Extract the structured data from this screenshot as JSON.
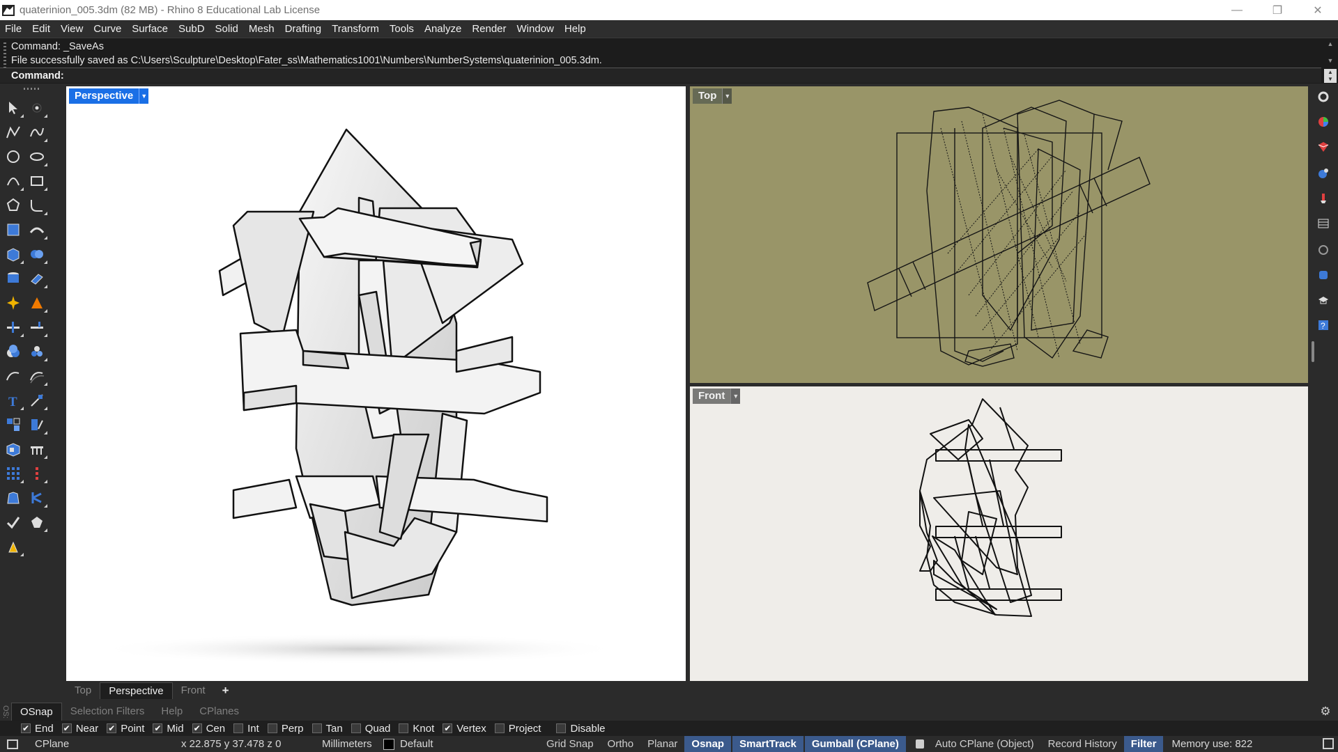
{
  "window": {
    "title": "quaterinion_005.3dm (82 MB) - Rhino 8 Educational Lab License",
    "minimize": "—",
    "restore": "❐",
    "close": "✕"
  },
  "menu": [
    "File",
    "Edit",
    "View",
    "Curve",
    "Surface",
    "SubD",
    "Solid",
    "Mesh",
    "Drafting",
    "Transform",
    "Tools",
    "Analyze",
    "Render",
    "Window",
    "Help"
  ],
  "command": {
    "history": [
      "Command: _SaveAs",
      "File successfully saved as C:\\Users\\Sculpture\\Desktop\\Fater_ss\\Mathematics1001\\Numbers\\NumberSystems\\quaterinion_005.3dm."
    ],
    "prompt": "Command:",
    "input_value": ""
  },
  "toolbar": {
    "tools": [
      "select-arrow-icon",
      "point-icon",
      "polyline-icon",
      "curve-icon",
      "circle-icon",
      "ellipse-icon",
      "arc-icon",
      "rectangle-icon",
      "polygon-icon",
      "fillet-curve-icon",
      "surface-icon",
      "loft-icon",
      "box-icon",
      "sphere-icon",
      "cylinder-icon",
      "extrude-icon",
      "explode-icon",
      "trim-icon",
      "split-icon",
      "join-icon",
      "boolean-union-icon",
      "boolean-split-icon",
      "rebuild-icon",
      "offset-icon",
      "text-icon",
      "dimension-icon",
      "group-icon",
      "move-icon",
      "block-icon",
      "array-icon",
      "grid-array-icon",
      "control-points-icon",
      "properties-icon",
      "analyze-icon",
      "check-icon",
      "render-icon",
      "paint-icon"
    ]
  },
  "viewports": {
    "perspective": {
      "label": "Perspective"
    },
    "top": {
      "label": "Top"
    },
    "front": {
      "label": "Front"
    }
  },
  "viewport_tabs": [
    "Top",
    "Perspective",
    "Front"
  ],
  "viewport_tab_add": "+",
  "right_panel_icons": [
    "settings-gear-icon",
    "color-wheel-icon",
    "material-icon",
    "environment-icon",
    "render-brush-icon",
    "layers-table-icon",
    "display-icon",
    "help-panel-icon",
    "learn-icon",
    "support-icon"
  ],
  "panel_tabs": [
    "OSnap",
    "Selection Filters",
    "Help",
    "CPlanes"
  ],
  "osnap": {
    "items": [
      {
        "label": "End",
        "checked": true
      },
      {
        "label": "Near",
        "checked": true
      },
      {
        "label": "Point",
        "checked": true
      },
      {
        "label": "Mid",
        "checked": true
      },
      {
        "label": "Cen",
        "checked": true
      },
      {
        "label": "Int",
        "checked": false
      },
      {
        "label": "Perp",
        "checked": false
      },
      {
        "label": "Tan",
        "checked": false
      },
      {
        "label": "Quad",
        "checked": false
      },
      {
        "label": "Knot",
        "checked": false
      },
      {
        "label": "Vertex",
        "checked": true
      },
      {
        "label": "Project",
        "checked": false
      },
      {
        "label": "Disable",
        "checked": false
      }
    ]
  },
  "status": {
    "cplane": "CPlane",
    "coords": "x 22.875  y 37.478  z 0",
    "units": "Millimeters",
    "layer": "Default",
    "toggles": [
      {
        "label": "Grid Snap",
        "on": false
      },
      {
        "label": "Ortho",
        "on": false
      },
      {
        "label": "Planar",
        "on": false
      },
      {
        "label": "Osnap",
        "on": true
      },
      {
        "label": "SmartTrack",
        "on": true
      },
      {
        "label": "Gumball (CPlane)",
        "on": true
      }
    ],
    "auto_cplane": "Auto CPlane (Object)",
    "record_history": "Record History",
    "filter": "Filter",
    "memory": "Memory use: 822"
  },
  "colors": {
    "accent_blue": "#1a6fe6",
    "top_viewport_bg": "#999568",
    "front_viewport_bg": "#efede9",
    "status_toggle_on": "#3b5a8c"
  }
}
